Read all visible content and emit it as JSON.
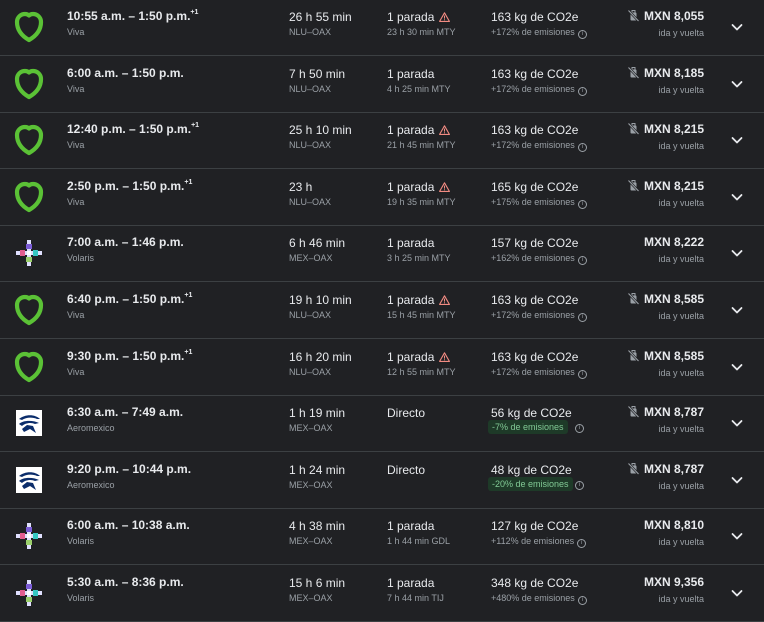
{
  "colors": {
    "viva": "#5bc236",
    "aeromexico_bg": "#0b2d6b",
    "accent_good": "#81c995",
    "warning": "#f28b82"
  },
  "flights": [
    {
      "airline": "Viva",
      "logo": "viva-logo",
      "departure_arrival": "10:55 a.m. – 1:50 p.m.",
      "day_offset": "+1",
      "duration": "26 h 55 min",
      "route": "NLU–OAX",
      "stops": "1 parada",
      "stop_warning": true,
      "stop_detail": "23 h 30 min MTY",
      "co2": "163 kg de CO2e",
      "emissions": "+172% de emisiones",
      "emissions_good": false,
      "price": "MXN 8,055",
      "no_bag": true,
      "trip_type": "ida y vuelta"
    },
    {
      "airline": "Viva",
      "logo": "viva-logo",
      "departure_arrival": "6:00 a.m. – 1:50 p.m.",
      "day_offset": "",
      "duration": "7 h 50 min",
      "route": "NLU–OAX",
      "stops": "1 parada",
      "stop_warning": false,
      "stop_detail": "4 h 25 min MTY",
      "co2": "163 kg de CO2e",
      "emissions": "+172% de emisiones",
      "emissions_good": false,
      "price": "MXN 8,185",
      "no_bag": true,
      "trip_type": "ida y vuelta"
    },
    {
      "airline": "Viva",
      "logo": "viva-logo",
      "departure_arrival": "12:40 p.m. – 1:50 p.m.",
      "day_offset": "+1",
      "duration": "25 h 10 min",
      "route": "NLU–OAX",
      "stops": "1 parada",
      "stop_warning": true,
      "stop_detail": "21 h 45 min MTY",
      "co2": "163 kg de CO2e",
      "emissions": "+172% de emisiones",
      "emissions_good": false,
      "price": "MXN 8,215",
      "no_bag": true,
      "trip_type": "ida y vuelta"
    },
    {
      "airline": "Viva",
      "logo": "viva-logo",
      "departure_arrival": "2:50 p.m. – 1:50 p.m.",
      "day_offset": "+1",
      "duration": "23 h",
      "route": "NLU–OAX",
      "stops": "1 parada",
      "stop_warning": true,
      "stop_detail": "19 h 35 min MTY",
      "co2": "165 kg de CO2e",
      "emissions": "+175% de emisiones",
      "emissions_good": false,
      "price": "MXN 8,215",
      "no_bag": true,
      "trip_type": "ida y vuelta"
    },
    {
      "airline": "Volaris",
      "logo": "volaris-logo",
      "departure_arrival": "7:00 a.m. – 1:46 p.m.",
      "day_offset": "",
      "duration": "6 h 46 min",
      "route": "MEX–OAX",
      "stops": "1 parada",
      "stop_warning": false,
      "stop_detail": "3 h 25 min MTY",
      "co2": "157 kg de CO2e",
      "emissions": "+162% de emisiones",
      "emissions_good": false,
      "price": "MXN 8,222",
      "no_bag": false,
      "trip_type": "ida y vuelta"
    },
    {
      "airline": "Viva",
      "logo": "viva-logo",
      "departure_arrival": "6:40 p.m. – 1:50 p.m.",
      "day_offset": "+1",
      "duration": "19 h 10 min",
      "route": "NLU–OAX",
      "stops": "1 parada",
      "stop_warning": true,
      "stop_detail": "15 h 45 min MTY",
      "co2": "163 kg de CO2e",
      "emissions": "+172% de emisiones",
      "emissions_good": false,
      "price": "MXN 8,585",
      "no_bag": true,
      "trip_type": "ida y vuelta"
    },
    {
      "airline": "Viva",
      "logo": "viva-logo",
      "departure_arrival": "9:30 p.m. – 1:50 p.m.",
      "day_offset": "+1",
      "duration": "16 h 20 min",
      "route": "NLU–OAX",
      "stops": "1 parada",
      "stop_warning": true,
      "stop_detail": "12 h 55 min MTY",
      "co2": "163 kg de CO2e",
      "emissions": "+172% de emisiones",
      "emissions_good": false,
      "price": "MXN 8,585",
      "no_bag": true,
      "trip_type": "ida y vuelta"
    },
    {
      "airline": "Aeromexico",
      "logo": "aeromexico-logo",
      "departure_arrival": "6:30 a.m. – 7:49 a.m.",
      "day_offset": "",
      "duration": "1 h 19 min",
      "route": "MEX–OAX",
      "stops": "Directo",
      "stop_warning": false,
      "stop_detail": "",
      "co2": "56 kg de CO2e",
      "emissions": "-7% de emisiones",
      "emissions_good": true,
      "price": "MXN 8,787",
      "no_bag": true,
      "trip_type": "ida y vuelta"
    },
    {
      "airline": "Aeromexico",
      "logo": "aeromexico-logo",
      "departure_arrival": "9:20 p.m. – 10:44 p.m.",
      "day_offset": "",
      "duration": "1 h 24 min",
      "route": "MEX–OAX",
      "stops": "Directo",
      "stop_warning": false,
      "stop_detail": "",
      "co2": "48 kg de CO2e",
      "emissions": "-20% de emisiones",
      "emissions_good": true,
      "price": "MXN 8,787",
      "no_bag": true,
      "trip_type": "ida y vuelta"
    },
    {
      "airline": "Volaris",
      "logo": "volaris-logo",
      "departure_arrival": "6:00 a.m. – 10:38 a.m.",
      "day_offset": "",
      "duration": "4 h 38 min",
      "route": "MEX–OAX",
      "stops": "1 parada",
      "stop_warning": false,
      "stop_detail": "1 h 44 min GDL",
      "co2": "127 kg de CO2e",
      "emissions": "+112% de emisiones",
      "emissions_good": false,
      "price": "MXN 8,810",
      "no_bag": false,
      "trip_type": "ida y vuelta"
    },
    {
      "airline": "Volaris",
      "logo": "volaris-logo",
      "departure_arrival": "5:30 a.m. – 8:36 p.m.",
      "day_offset": "",
      "duration": "15 h 6 min",
      "route": "MEX–OAX",
      "stops": "1 parada",
      "stop_warning": false,
      "stop_detail": "7 h 44 min TIJ",
      "co2": "348 kg de CO2e",
      "emissions": "+480% de emisiones",
      "emissions_good": false,
      "price": "MXN 9,356",
      "no_bag": false,
      "trip_type": "ida y vuelta"
    }
  ]
}
